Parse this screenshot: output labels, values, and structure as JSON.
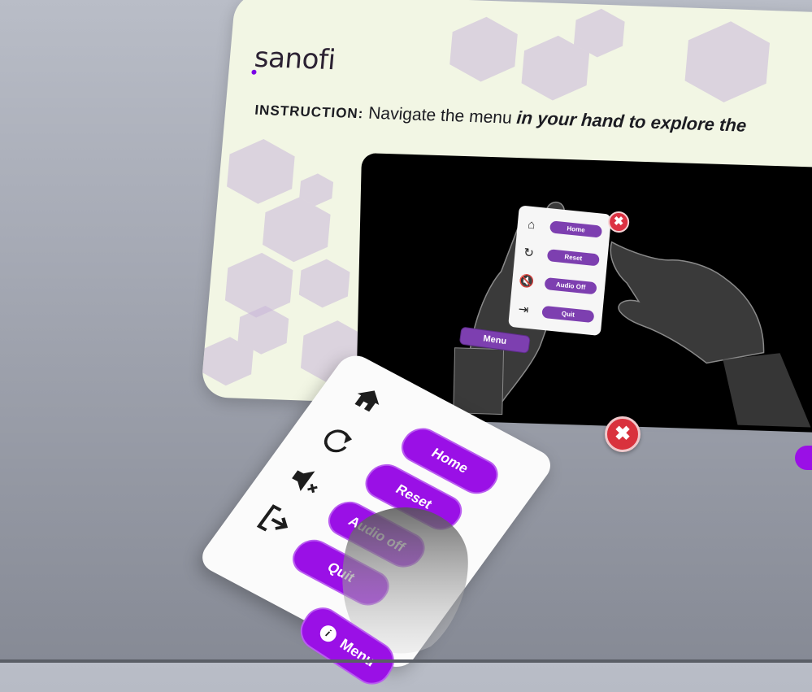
{
  "brand": {
    "name": "sanofi"
  },
  "instruction": {
    "label": "INSTRUCTION:",
    "text_plain": "Navigate the menu",
    "text_em": "in your hand to explore the"
  },
  "video_menu": {
    "items": [
      {
        "icon": "home-icon",
        "label": "Home"
      },
      {
        "icon": "reset-icon",
        "label": "Reset"
      },
      {
        "icon": "audio-off-icon",
        "label": "Audio Off"
      },
      {
        "icon": "quit-icon",
        "label": "Quit"
      }
    ],
    "tab_label": "Menu",
    "close_glyph": "✖"
  },
  "hand_menu": {
    "items": [
      {
        "icon": "home-icon",
        "label": "Home"
      },
      {
        "icon": "reset-icon",
        "label": "Reset"
      },
      {
        "icon": "audio-off-icon",
        "label": "Audio off"
      },
      {
        "icon": "quit-icon",
        "label": "Quit"
      }
    ],
    "close_glyph": "✖",
    "tab_label": "Menu",
    "info_glyph": "i"
  },
  "colors": {
    "accent": "#9a10e6",
    "video_button": "#7d3fb0",
    "close": "#d9323d",
    "board_bg": "#f2f6e4",
    "hexagon": "#c9b6d8"
  }
}
